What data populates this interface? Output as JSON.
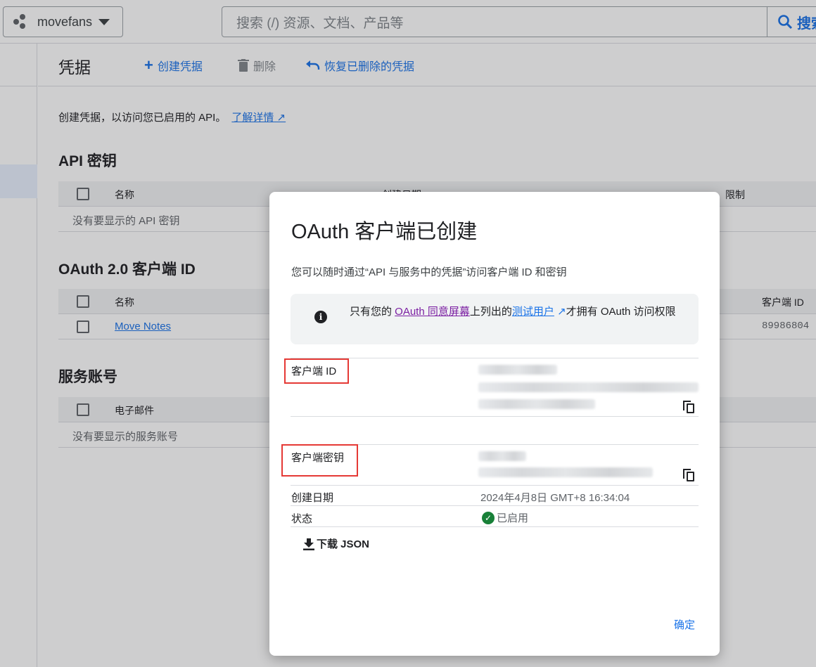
{
  "topbar": {
    "project_name": "movefans",
    "search_placeholder": "搜索 (/) 资源、文档、产品等",
    "search_button": "搜索"
  },
  "actionbar": {
    "title": "凭据",
    "create": "创建凭据",
    "delete": "删除",
    "restore": "恢复已删除的凭据"
  },
  "intro": {
    "text": "创建凭据，以访问您已启用的 API。",
    "link": "了解详情"
  },
  "api_keys": {
    "title": "API 密钥",
    "col_name": "名称",
    "col_created": "创建日期",
    "col_restrict": "限制",
    "empty": "没有要显示的 API 密钥"
  },
  "oauth": {
    "title": "OAuth 2.0 客户端 ID",
    "col_name": "名称",
    "col_client_id": "客户端 ID",
    "rows": [
      {
        "name": "Move Notes",
        "client_id": "89986804"
      }
    ]
  },
  "service_accounts": {
    "title": "服务账号",
    "col_email": "电子邮件",
    "empty": "没有要显示的服务账号"
  },
  "dialog": {
    "title": "OAuth 客户端已创建",
    "description": "您可以随时通过“API 与服务中的凭据”访问客户端 ID 和密钥",
    "info": {
      "part1": "只有您的 ",
      "link1": "OAuth 同意屏幕",
      "part2": "上列出的",
      "link2": "测试用户",
      "part3": "才拥有 OAuth 访问权限"
    },
    "client_id_label": "客户端 ID",
    "client_secret_label": "客户端密钥",
    "created_label": "创建日期",
    "created_value": "2024年4月8日 GMT+8 16:34:04",
    "status_label": "状态",
    "status_value": "已启用",
    "download": "下载 JSON",
    "ok": "确定"
  },
  "colors": {
    "accent": "#1a73e8",
    "highlight_box": "#e53935",
    "status_ok": "#188038"
  }
}
